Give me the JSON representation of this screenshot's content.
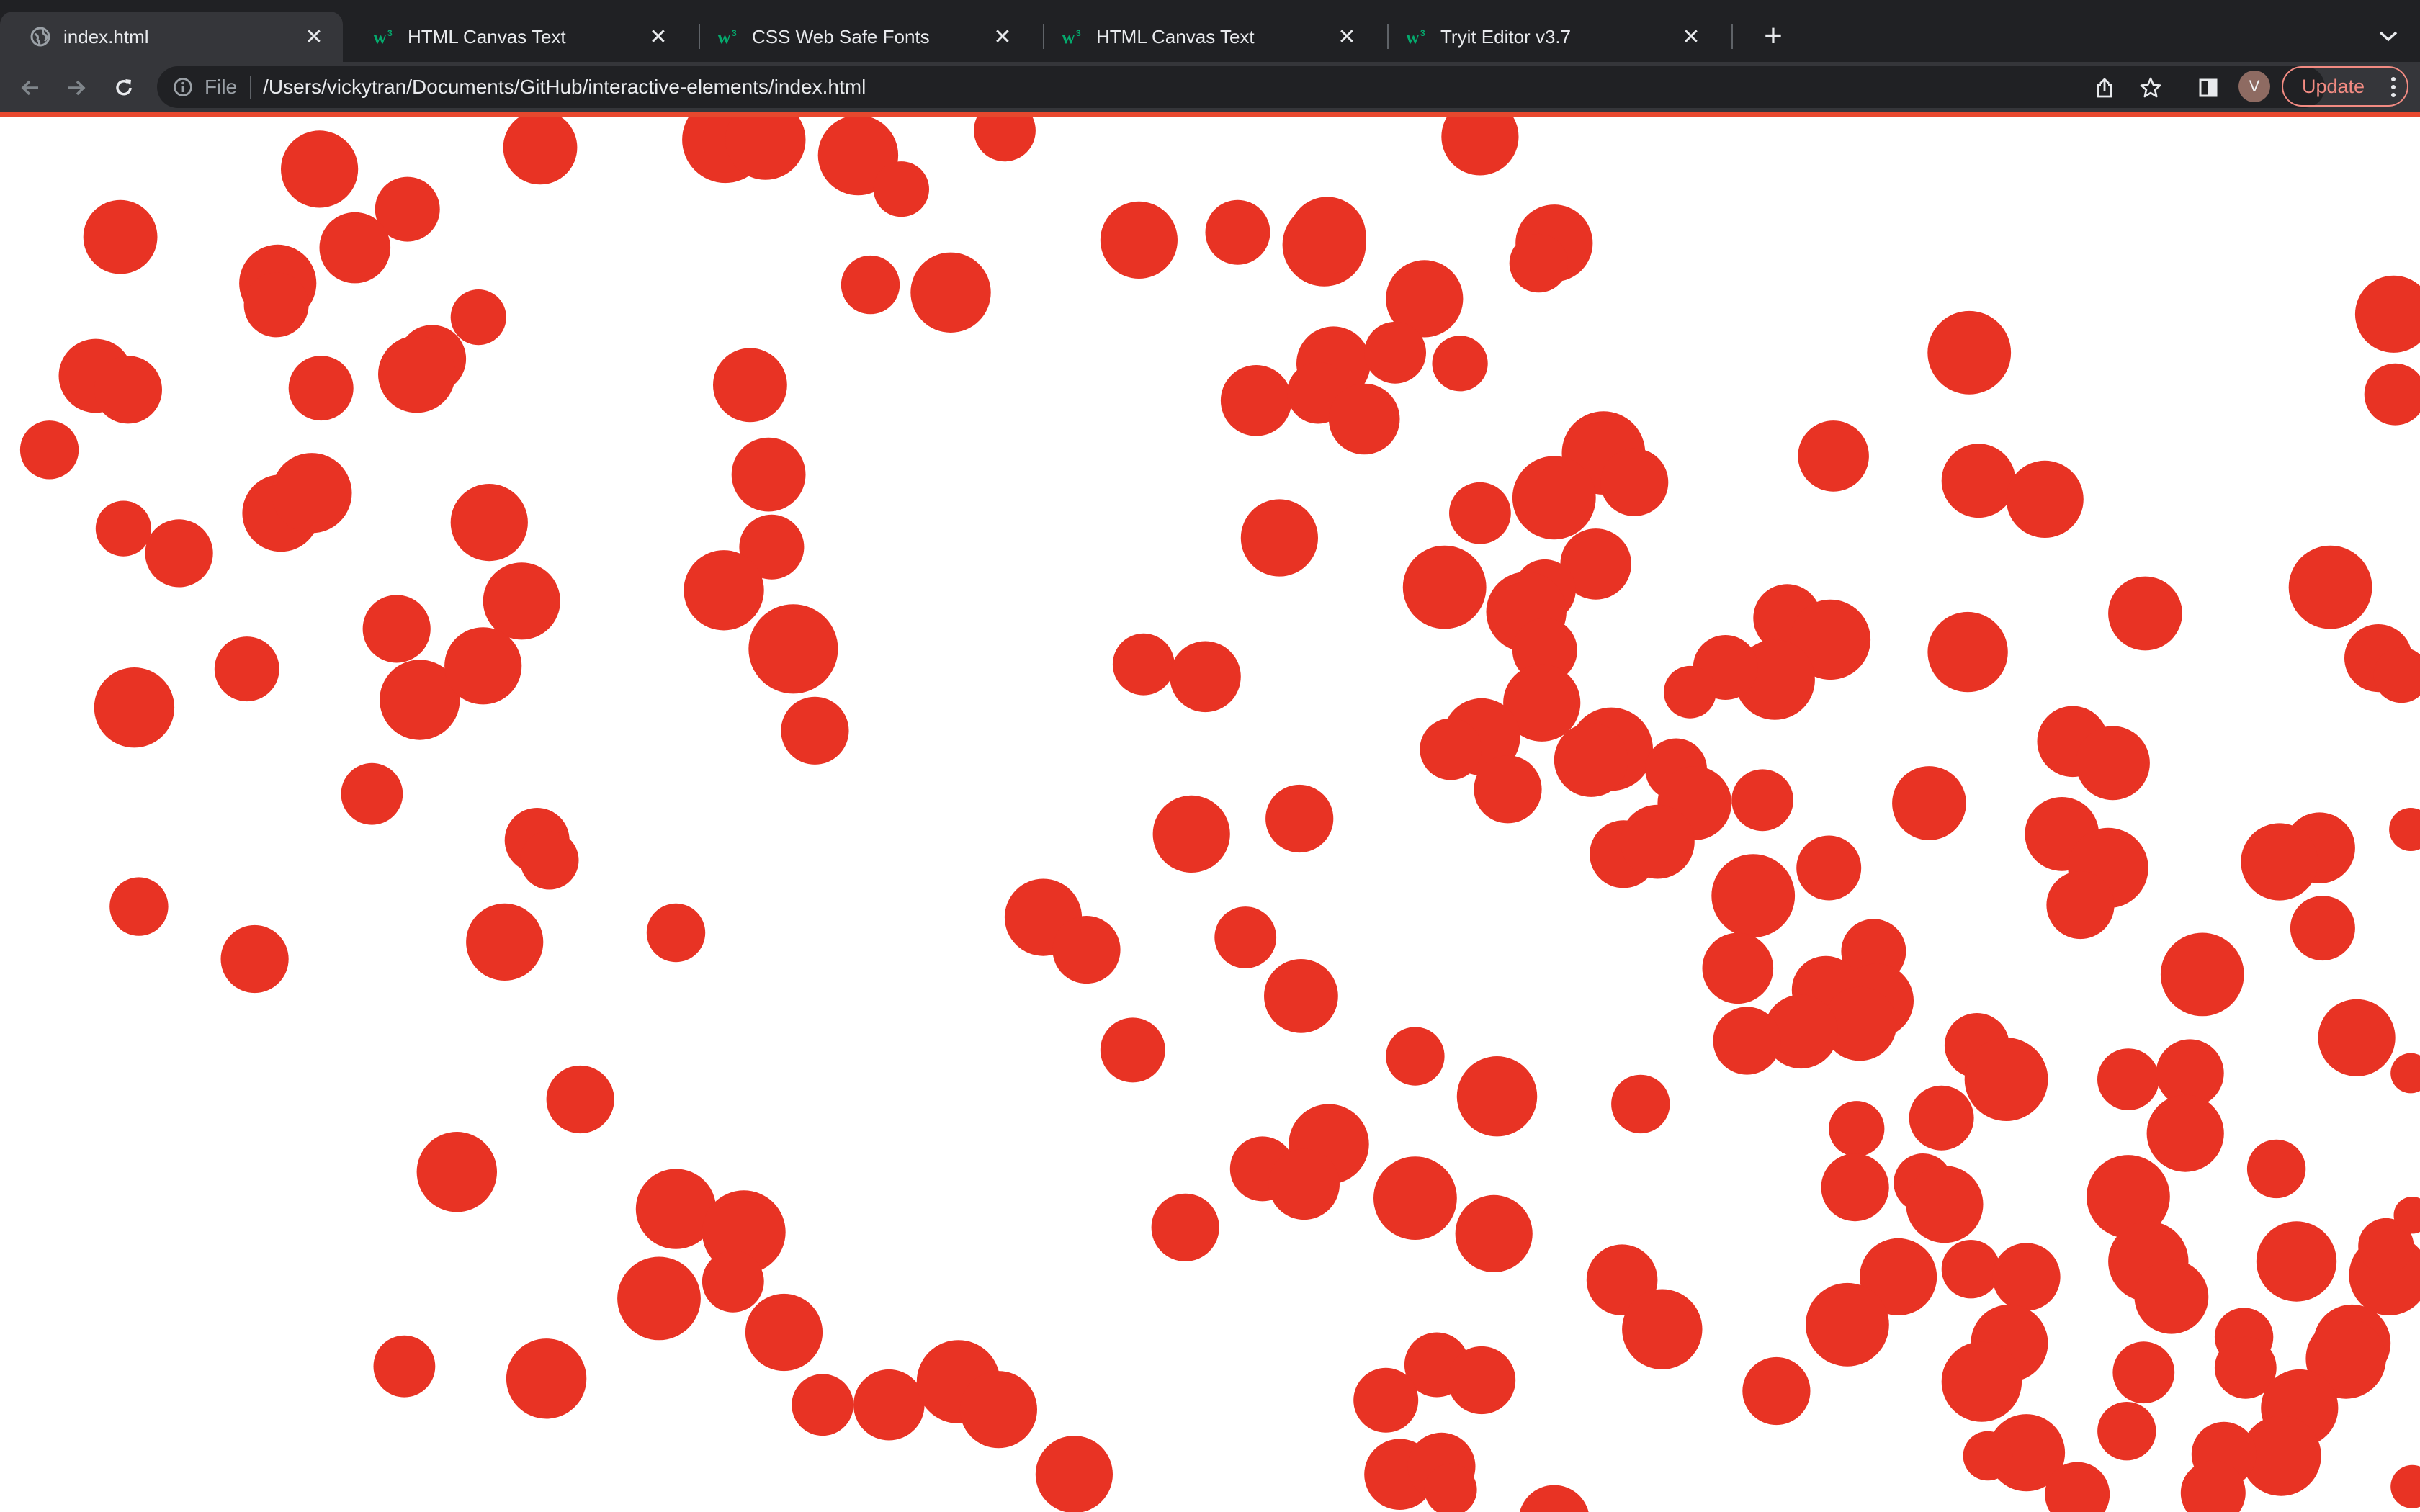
{
  "browser": {
    "tabs": [
      {
        "title": "index.html",
        "favicon": "globe-icon",
        "active": true
      },
      {
        "title": "HTML Canvas Text",
        "favicon": "w3schools-icon",
        "active": false
      },
      {
        "title": "CSS Web Safe Fonts",
        "favicon": "w3schools-icon",
        "active": false
      },
      {
        "title": "HTML Canvas Text",
        "favicon": "w3schools-icon",
        "active": false
      },
      {
        "title": "Tryit Editor v3.7",
        "favicon": "w3schools-icon",
        "active": false
      }
    ],
    "address": {
      "scheme_label": "File",
      "url": "/Users/vickytran/Documents/GitHub/interactive-elements/index.html"
    },
    "profile_initial": "V",
    "update_label": "Update"
  },
  "page": {
    "circle_color": "#e83324",
    "background": "#ffffff"
  }
}
